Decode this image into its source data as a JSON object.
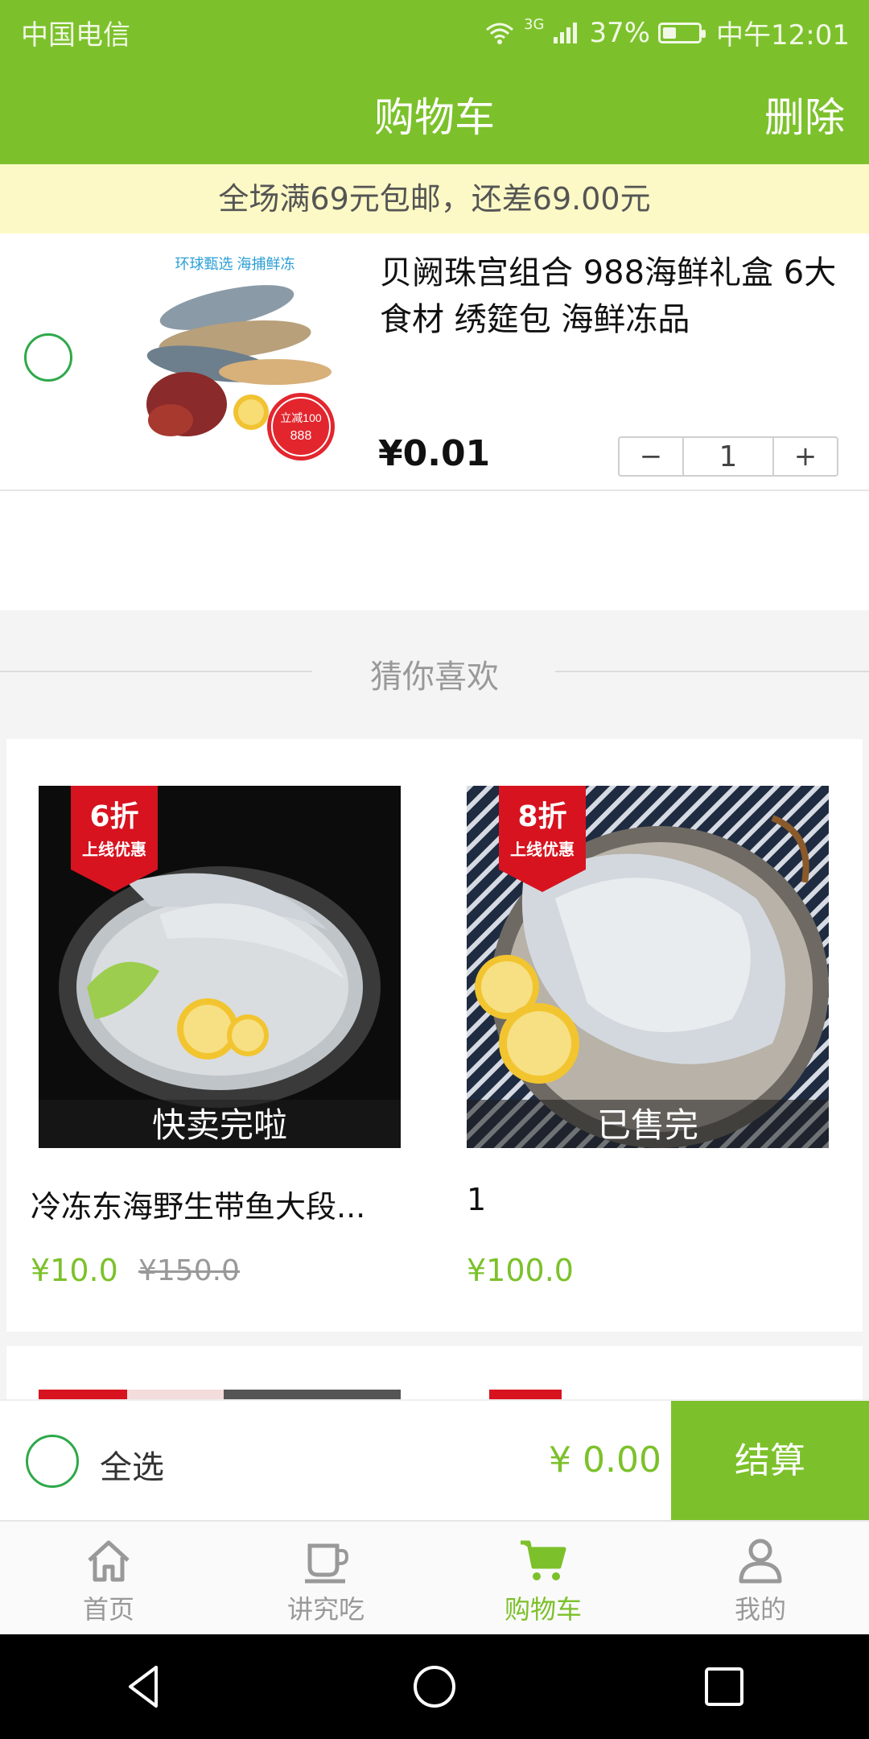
{
  "status_bar": {
    "carrier": "中国电信",
    "network": "3G",
    "battery": "37%",
    "battery_level": 0.37,
    "time": "中午12:01"
  },
  "header": {
    "title": "购物车",
    "delete_label": "删除"
  },
  "notice": {
    "text": "全场满69元包邮，还差69.00元"
  },
  "cart_item": {
    "image_caption": "环球甄选 海捕鲜冻",
    "image_badge_top": "立减100",
    "image_badge_bottom": "888",
    "title": "贝阙珠宫组合 988海鲜礼盒 6大食材 绣筵包 海鲜冻品",
    "price": "¥0.01",
    "quantity": "1",
    "minus_label": "−",
    "plus_label": "+"
  },
  "recommend": {
    "title": "猜你喜欢",
    "items": [
      {
        "badge_main": "6折",
        "badge_sub": "上线优惠",
        "status": "快卖完啦",
        "name": "冷冻东海野生带鱼大段...",
        "price": "¥10.0",
        "old_price": "¥150.0"
      },
      {
        "badge_main": "8折",
        "badge_sub": "上线优惠",
        "status": "已售完",
        "name": "1",
        "price": "¥100.0",
        "old_price": ""
      }
    ]
  },
  "checkout": {
    "select_all": "全选",
    "total": "¥ 0.00",
    "pay_label": "结算"
  },
  "tabs": [
    {
      "label": "首页",
      "icon": "home-icon",
      "active": false
    },
    {
      "label": "讲究吃",
      "icon": "cup-icon",
      "active": false
    },
    {
      "label": "购物车",
      "icon": "cart-icon",
      "active": true
    },
    {
      "label": "我的",
      "icon": "user-icon",
      "active": false
    }
  ],
  "colors": {
    "brand": "#7cc12b",
    "radio": "#2ea84a",
    "badge": "#d7131f"
  }
}
